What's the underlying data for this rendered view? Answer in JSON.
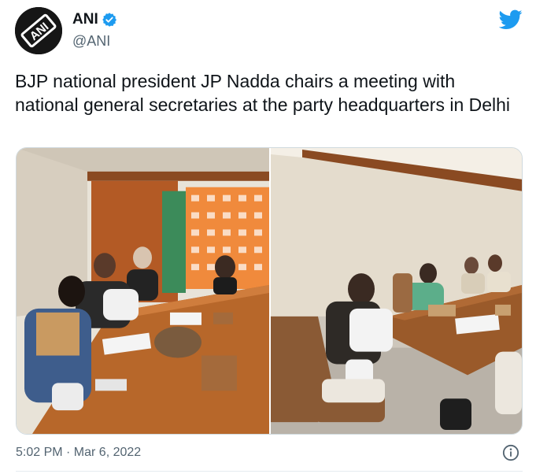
{
  "tweet": {
    "author": {
      "display_name": "ANI",
      "handle": "@ANI",
      "verified": true,
      "avatar_logo_text": "ANI"
    },
    "text": "BJP national president JP Nadda chairs a meeting with national general secretaries at the party headquarters in Delhi",
    "timestamp": "5:02 PM · Mar 6, 2022",
    "media_count": 2
  },
  "icons": {
    "brand": "twitter-bird-icon",
    "verified": "verified-badge-icon",
    "info": "info-icon"
  },
  "colors": {
    "twitter_blue": "#1d9bf0",
    "text_primary": "#0f1419",
    "text_secondary": "#536471",
    "border": "#cfd9de"
  }
}
